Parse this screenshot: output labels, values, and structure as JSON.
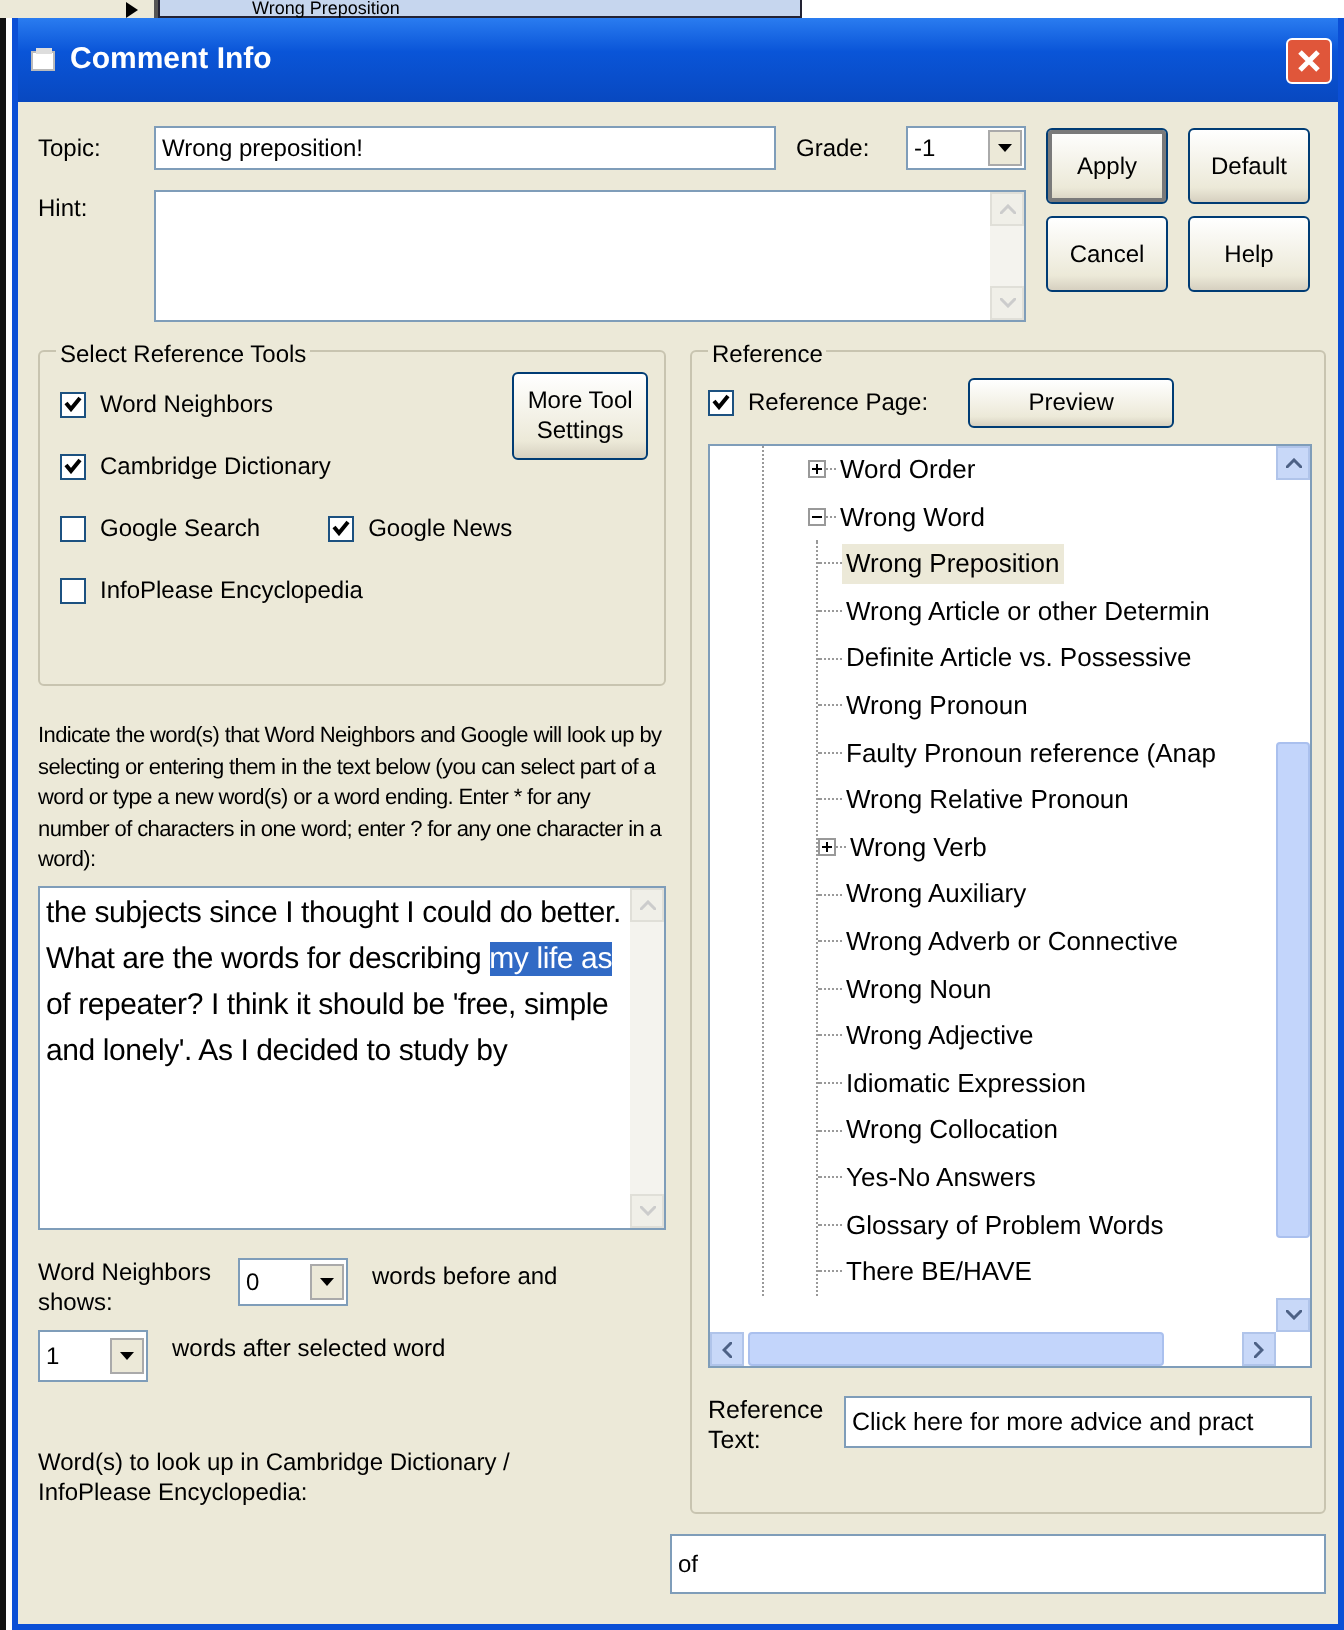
{
  "background_window": {
    "item": "Wrong Preposition"
  },
  "window": {
    "title": "Comment Info"
  },
  "topic": {
    "label": "Topic:",
    "value": "Wrong preposition!"
  },
  "grade": {
    "label": "Grade:",
    "value": "-1"
  },
  "hint": {
    "label": "Hint:"
  },
  "buttons": [
    {
      "label": "Apply",
      "default": true
    },
    {
      "label": "Default",
      "default": false
    },
    {
      "label": "Cancel",
      "default": false
    },
    {
      "label": "Help",
      "default": false
    }
  ],
  "reference_tools": {
    "title": "Select Reference Tools",
    "more_button": "More Tool Settings",
    "rows": [
      [
        {
          "label": "Word Neighbors",
          "checked": true
        }
      ],
      [
        {
          "label": "Cambridge Dictionary",
          "checked": true
        }
      ],
      [
        {
          "label": "Google Search",
          "checked": false
        },
        {
          "label": "Google News",
          "checked": true
        }
      ],
      [
        {
          "label": "InfoPlease Encyclopedia",
          "checked": false
        }
      ]
    ]
  },
  "instructions": "Indicate the word(s) that Word Neighbors and Google will look up by selecting or entering them in the text below (you can select part of a word or type a new word(s) or a word ending. Enter * for any number of characters in one word; enter ? for any one character in a word):",
  "text_area": {
    "before": "the subjects since I thought I could do better.  What are the words for describing ",
    "selected": "my life as",
    "after": " of repeater? I think it should be 'free, simple and lonely'. As I decided to study by"
  },
  "neighbors": {
    "label": "Word Neighbors shows:",
    "before_value": "0",
    "before_label": "words before and",
    "after_value": "1",
    "after_label": "words after selected word"
  },
  "lookup": {
    "label": "Word(s) to look up in Cambridge Dictionary / InfoPlease Encyclopedia:",
    "value": "of"
  },
  "reference": {
    "title": "Reference",
    "page_label": "Reference Page:",
    "page_checked": true,
    "preview_button": "Preview",
    "tree": [
      {
        "label": "Word Order",
        "expanded": false,
        "selected": false
      },
      {
        "label": "Wrong Word",
        "expanded": true,
        "selected": false,
        "children": [
          {
            "label": "Wrong Preposition",
            "selected": true
          },
          {
            "label": "Wrong Article or other Determin",
            "selected": false
          },
          {
            "label": "Definite Article vs. Possessive",
            "selected": false
          },
          {
            "label": "Wrong Pronoun",
            "selected": false
          },
          {
            "label": "Faulty Pronoun reference (Anap",
            "selected": false
          },
          {
            "label": "Wrong Relative Pronoun",
            "selected": false
          },
          {
            "label": "Wrong Verb",
            "expanded": false,
            "selected": false
          },
          {
            "label": "Wrong Auxiliary",
            "selected": false
          },
          {
            "label": "Wrong Adverb or Connective",
            "selected": false
          },
          {
            "label": "Wrong Noun",
            "selected": false
          },
          {
            "label": "Wrong Adjective",
            "selected": false
          },
          {
            "label": "Idiomatic Expression",
            "selected": false
          },
          {
            "label": "Wrong Collocation",
            "selected": false
          },
          {
            "label": "Yes-No Answers",
            "selected": false
          },
          {
            "label": "Glossary of Problem Words",
            "selected": false
          },
          {
            "label": "There BE/HAVE",
            "selected": false
          }
        ]
      }
    ],
    "text_label": "Reference Text:",
    "text_value": "Click here for more advice and pract"
  }
}
